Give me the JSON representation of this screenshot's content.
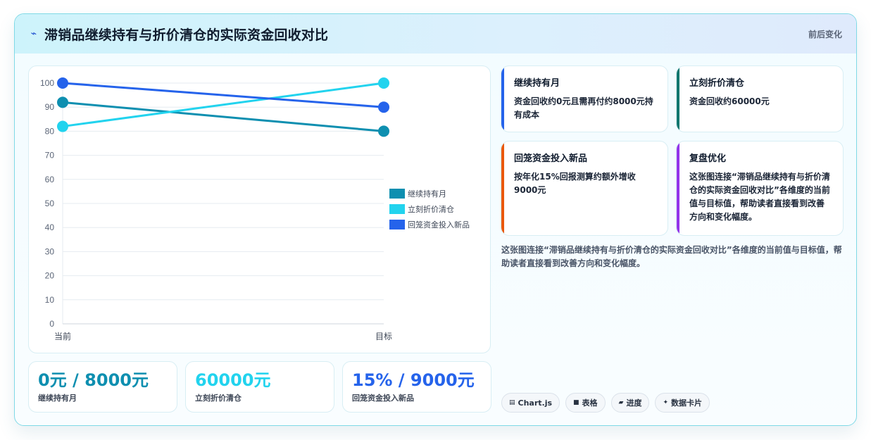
{
  "header": {
    "title": "滞销品继续持有与折价清仓的实际资金回收对比",
    "right_label": "前后变化"
  },
  "chart_data": {
    "type": "line",
    "x": [
      "当前",
      "目标"
    ],
    "ylim": [
      0,
      100
    ],
    "yticks": [
      0,
      10,
      20,
      30,
      40,
      50,
      60,
      70,
      80,
      90,
      100
    ],
    "grid": true,
    "legend_position": "right",
    "series": [
      {
        "name": "继续持有月",
        "values": [
          92,
          80
        ],
        "color": "#0e8fb0"
      },
      {
        "name": "立刻折价清仓",
        "values": [
          82,
          100
        ],
        "color": "#22d3ee"
      },
      {
        "name": "回笼资金投入新品",
        "values": [
          100,
          90
        ],
        "color": "#2563eb"
      }
    ]
  },
  "kpis": [
    {
      "value": "0元 / 8000元",
      "label": "继续持有月",
      "color": "#0e8fb0"
    },
    {
      "value": "60000元",
      "label": "立刻折价清仓",
      "color": "#22d3ee"
    },
    {
      "value": "15% / 9000元",
      "label": "回笼资金投入新品",
      "color": "#2563eb"
    }
  ],
  "info_cards": [
    {
      "title": "继续持有月",
      "text": "资金回收约0元且需再付约8000元持有成本",
      "accent": "#2563eb"
    },
    {
      "title": "立刻折价清仓",
      "text": "资金回收约60000元",
      "accent": "#0f766e"
    },
    {
      "title": "回笼资金投入新品",
      "text": "按年化15%回报测算约额外增收9000元",
      "accent": "#ea580c"
    },
    {
      "title": "复盘优化",
      "text": "这张图连接“滞销品继续持有与折价清仓的实际资金回收对比”各维度的当前值与目标值，帮助读者直接看到改善方向和变化幅度。",
      "accent": "#9333ea"
    }
  ],
  "summary": "这张图连接“滞销品继续持有与折价清仓的实际资金回收对比”各维度的当前值与目标值，帮助读者直接看到改善方向和变化幅度。",
  "tags": [
    {
      "icon": "chart-icon",
      "glyph": "▤",
      "label": "Chart.js"
    },
    {
      "icon": "table-icon",
      "glyph": "■",
      "label": "表格"
    },
    {
      "icon": "progress-icon",
      "glyph": "▰",
      "label": "进度"
    },
    {
      "icon": "sparkle-icon",
      "glyph": "✦",
      "label": "数据卡片"
    }
  ]
}
